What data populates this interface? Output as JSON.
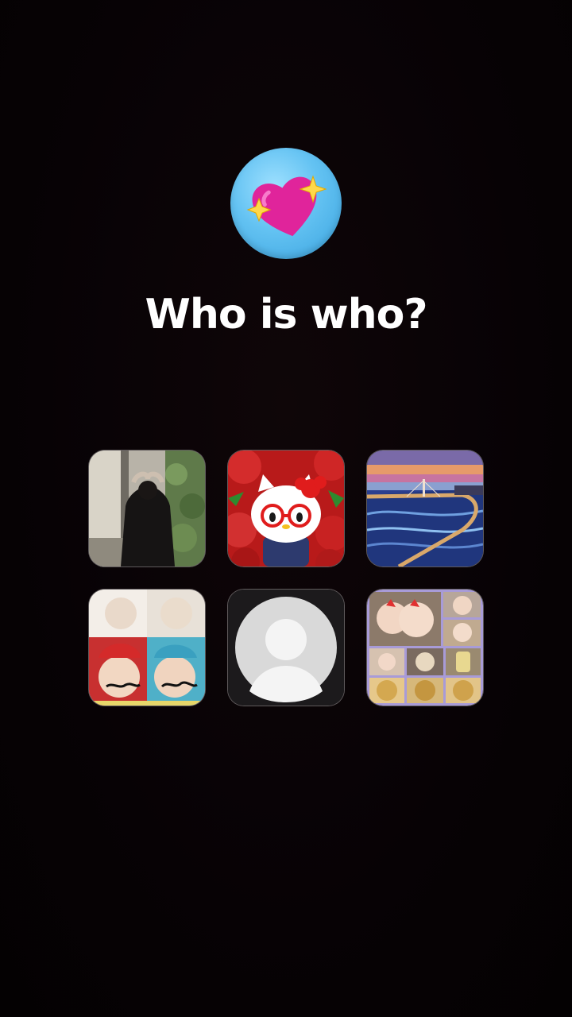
{
  "prompt": {
    "emoji": "heart-with-sparkles-icon",
    "title": "Who is who?"
  },
  "colors": {
    "background": "#070205",
    "badge": "#63c2f2",
    "heart": "#e0249b",
    "title_text": "#ffffff"
  },
  "avatars": [
    {
      "name": "avatar-photo-person-heart-hands"
    },
    {
      "name": "avatar-hello-kitty-strawberries"
    },
    {
      "name": "avatar-painting-bridge-sunset"
    },
    {
      "name": "avatar-selfie-collage-mustache"
    },
    {
      "name": "avatar-default-placeholder"
    },
    {
      "name": "avatar-photo-collage-food"
    }
  ]
}
